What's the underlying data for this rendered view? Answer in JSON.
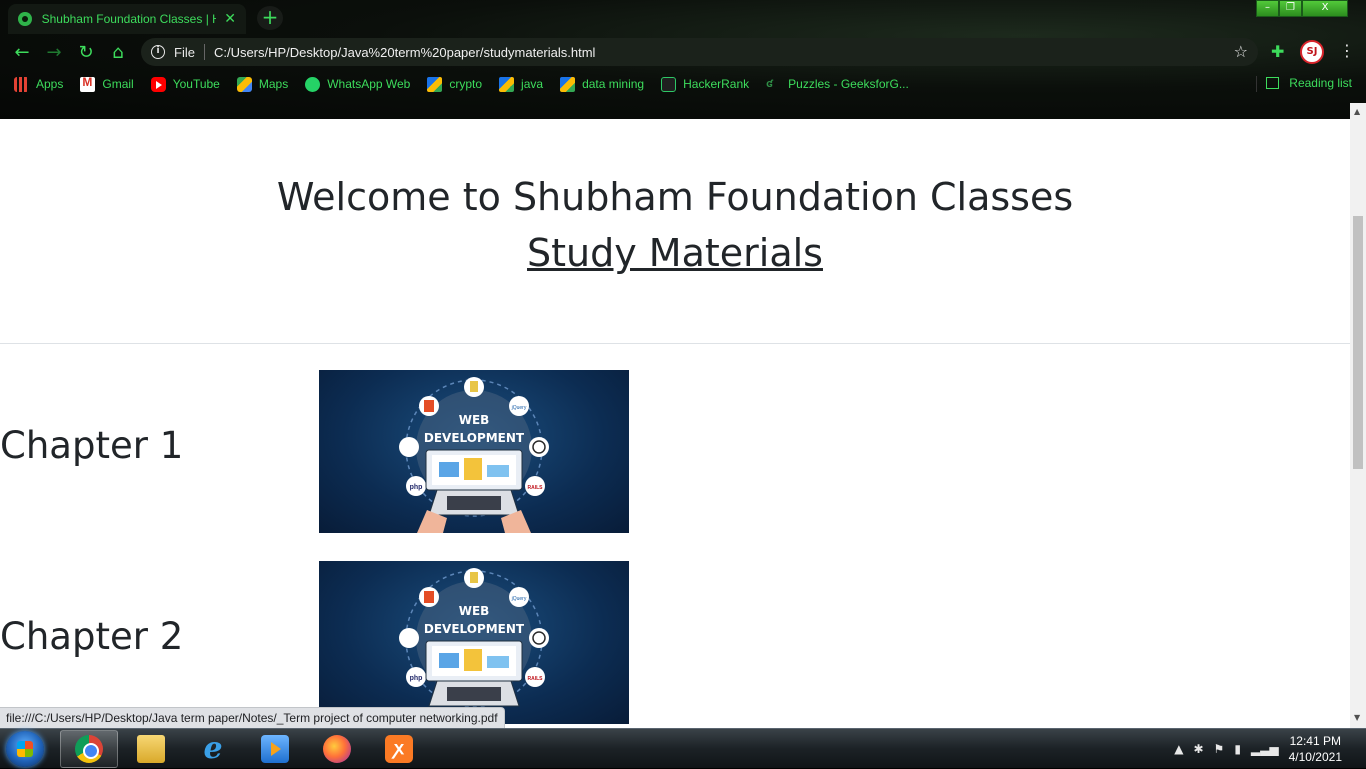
{
  "browser": {
    "tab_title": "Shubham Foundation Classes | H",
    "tab_close": "✕",
    "new_tab": "+",
    "file_label": "File",
    "url": "C:/Users/HP/Desktop/Java%20term%20paper/studymaterials.html",
    "accent_color": "#3ddc5c",
    "bookmarks": [
      {
        "label": "Apps",
        "icon": "apps-icon"
      },
      {
        "label": "Gmail",
        "icon": "gmail-icon"
      },
      {
        "label": "YouTube",
        "icon": "youtube-icon"
      },
      {
        "label": "Maps",
        "icon": "maps-icon"
      },
      {
        "label": "WhatsApp Web",
        "icon": "whatsapp-icon"
      },
      {
        "label": "crypto",
        "icon": "drive-icon"
      },
      {
        "label": "java",
        "icon": "drive-icon"
      },
      {
        "label": "data mining",
        "icon": "drive-icon"
      },
      {
        "label": "HackerRank",
        "icon": "hackerrank-icon"
      },
      {
        "label": "Puzzles - GeeksforG...",
        "icon": "geeksforgeeks-icon"
      }
    ],
    "reading_list": "Reading list"
  },
  "page": {
    "title": "Welcome to Shubham Foundation Classes",
    "subtitle": "Study Materials",
    "chapters": [
      {
        "label": "Chapter 1",
        "image_text_1": "WEB",
        "image_text_2": "DEVELOPMENT"
      },
      {
        "label": "Chapter 2",
        "image_text_1": "WEB",
        "image_text_2": "DEVELOPMENT"
      }
    ],
    "image_badges": {
      "php": "php",
      "rails": "RAILS",
      "jquery": "jQuery"
    }
  },
  "status_bar": {
    "link": "file:///C:/Users/HP/Desktop/Java term paper/Notes/_Term project of computer networking.pdf"
  },
  "taskbar": {
    "apps": [
      "chrome-icon",
      "file-explorer-icon",
      "internet-explorer-icon",
      "media-player-icon",
      "firefox-icon",
      "xampp-icon"
    ],
    "time": "12:41 PM",
    "date": "4/10/2021"
  }
}
